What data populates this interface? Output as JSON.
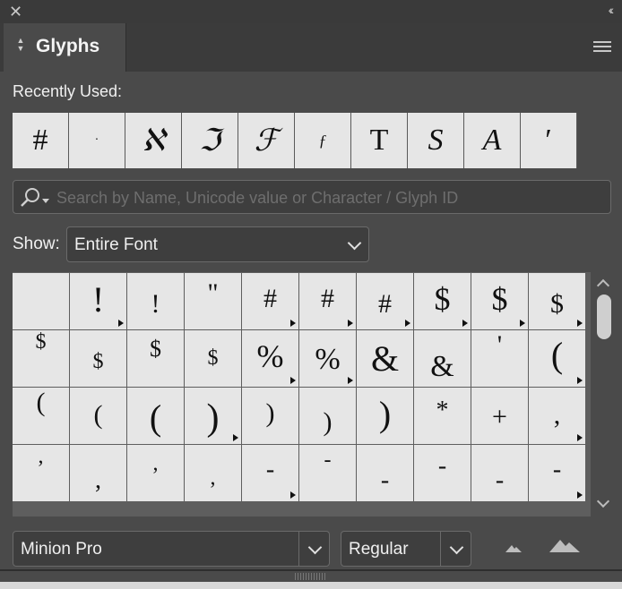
{
  "panel": {
    "tab_title": "Glyphs"
  },
  "recently_used": {
    "label": "Recently Used:",
    "glyphs": [
      "#",
      "·",
      "ℵ",
      "ℑ",
      "ℱ",
      "ƒ",
      "T",
      "S",
      "A",
      "′"
    ]
  },
  "search": {
    "placeholder": "Search by Name, Unicode value or Character / Glyph ID",
    "value": ""
  },
  "show": {
    "label": "Show:",
    "value": "Entire Font"
  },
  "glyph_grid": {
    "rows": [
      [
        "",
        "!",
        "!",
        "\"",
        "#",
        "#",
        "#",
        "$",
        "$",
        "$"
      ],
      [
        "$",
        "$",
        "$",
        "$",
        "%",
        "%",
        "&",
        "&",
        "'",
        "("
      ],
      [
        "(",
        "(",
        "(",
        ")",
        ")",
        ")",
        ")",
        "*",
        "+",
        ","
      ],
      [
        ",",
        ",",
        ",",
        ",",
        "-",
        "-",
        "-",
        "-",
        "-",
        "-"
      ]
    ]
  },
  "font": {
    "family": "Minion Pro",
    "style": "Regular"
  },
  "colors": {
    "panel_bg": "#4a4a4a",
    "cell_bg": "#e6e6e6",
    "glyph": "#111111",
    "text": "#f0f0f0"
  }
}
